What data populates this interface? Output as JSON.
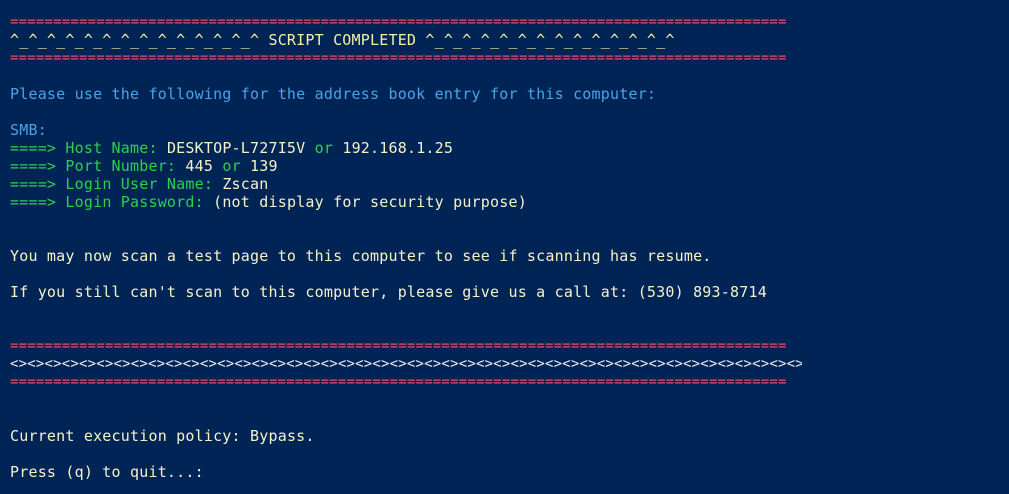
{
  "colors": {
    "background": "#012456",
    "border": "#e84d6b",
    "banner": "#f2f2a0",
    "label": "#2bd24b",
    "heading": "#4aa3e8",
    "text": "#f5f3c8"
  },
  "banner_top": {
    "rule_top": "==========================================================================================",
    "title": "^_^_^_^_^_^_^_^_^_^_^_^_^_^ SCRIPT COMPLETED ^_^_^_^_^_^_^_^_^_^_^_^_^_^",
    "rule_bottom": "=========================================================================================="
  },
  "instruction": "Please use the following for the address book entry for this computer:",
  "smb": {
    "label": "SMB:",
    "arrow": "====>",
    "host_label": "Host Name:",
    "host_value": "DESKTOP-L727I5V",
    "host_or": "or",
    "host_ip": "192.168.1.25",
    "port_label": "Port Number:",
    "port_value_1": "445",
    "port_or": "or",
    "port_value_2": "139",
    "user_label": "Login User Name:",
    "user_value": "Zscan",
    "password_label": "Login Password:",
    "password_value": "(not display for security purpose)"
  },
  "message_scan": "You may now scan a test page to this computer to see if scanning has resume.",
  "message_call": "If you still can't scan to this computer, please give us a call at: (530) 893-8714",
  "banner_bottom": {
    "rule_top": "==========================================================================================",
    "pattern": "<><><><><><><><><><><><><><><><><><><><><><><><><><><><><><><><><><><><><><><><><><><><><><>",
    "rule_bottom": "=========================================================================================="
  },
  "policy": {
    "label": "Current execution policy:",
    "value": "Bypass."
  },
  "prompt": "Press (q) to quit...:"
}
